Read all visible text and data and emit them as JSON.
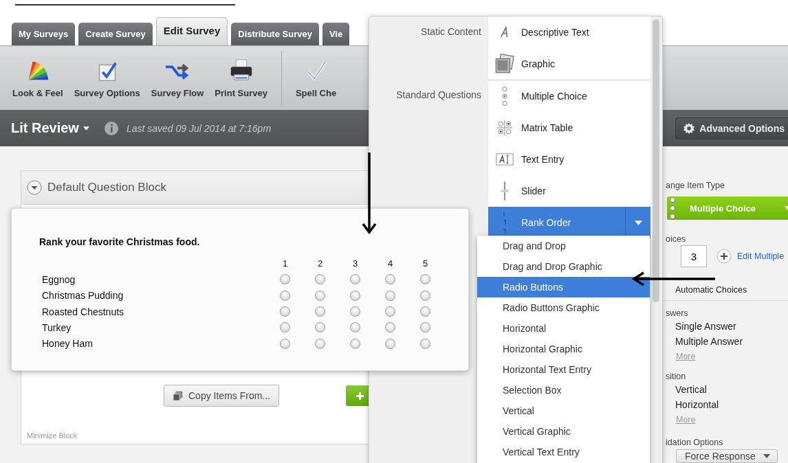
{
  "tabs": [
    {
      "label": "My Surveys",
      "selected": false
    },
    {
      "label": "Create Survey",
      "selected": false
    },
    {
      "label": "Edit Survey",
      "selected": true
    },
    {
      "label": "Distribute Survey",
      "selected": false
    },
    {
      "label": "Vie",
      "selected": false
    }
  ],
  "toolbar": [
    {
      "label": "Look & Feel",
      "kind": "palette"
    },
    {
      "label": "Survey Options",
      "kind": "options"
    },
    {
      "label": "Survey Flow",
      "kind": "flow"
    },
    {
      "label": "Print Survey",
      "kind": "print"
    },
    {
      "label": "Spell Che",
      "kind": "spell"
    }
  ],
  "survey_bar": {
    "title": "Lit Review",
    "last_saved": "Last saved 09 Jul 2014 at 7:16pm",
    "advanced_button": "Advanced Options"
  },
  "block": {
    "title": "Default Question Block",
    "copy_button": "Copy Items From...",
    "minimize_link": "Minimize Block"
  },
  "preview": {
    "question": "Rank your favorite Christmas food.",
    "scale": [
      "1",
      "2",
      "3",
      "4",
      "5"
    ],
    "rows": [
      {
        "label": "Eggnog",
        "checked": [
          false,
          false,
          false,
          false,
          false
        ]
      },
      {
        "label": "Christmas Pudding",
        "checked": [
          false,
          false,
          false,
          false,
          false
        ]
      },
      {
        "label": "Roasted Chestnuts",
        "checked": [
          false,
          false,
          false,
          false,
          false
        ]
      },
      {
        "label": "Turkey",
        "checked": [
          false,
          false,
          false,
          false,
          false
        ]
      },
      {
        "label": "Honey Ham",
        "checked": [
          false,
          false,
          false,
          false,
          false
        ]
      }
    ]
  },
  "question_types": [
    {
      "group": "Static Content",
      "items": [
        {
          "label": "Descriptive Text",
          "kind": "text",
          "selected": false
        },
        {
          "label": "Graphic",
          "kind": "graphic",
          "selected": false
        }
      ]
    },
    {
      "group": "Standard Questions",
      "items": [
        {
          "label": "Multiple Choice",
          "kind": "choice",
          "selected": false
        },
        {
          "label": "Matrix Table",
          "kind": "matrix",
          "selected": false
        },
        {
          "label": "Text Entry",
          "kind": "entry",
          "selected": false
        },
        {
          "label": "Slider",
          "kind": "slider",
          "selected": false
        },
        {
          "label": "Rank Order",
          "kind": "rank",
          "selected": true
        }
      ]
    }
  ],
  "submenu": [
    {
      "label": "Drag and Drop",
      "selected": false
    },
    {
      "label": "Drag and Drop Graphic",
      "selected": false
    },
    {
      "label": "Radio Buttons",
      "selected": true
    },
    {
      "label": "Radio Buttons Graphic",
      "selected": false
    },
    {
      "label": "Horizontal",
      "selected": false
    },
    {
      "label": "Horizontal Graphic",
      "selected": false
    },
    {
      "label": "Horizontal Text Entry",
      "selected": false
    },
    {
      "label": "Selection Box",
      "selected": false
    },
    {
      "label": "Vertical",
      "selected": false
    },
    {
      "label": "Vertical Graphic",
      "selected": false
    },
    {
      "label": "Vertical Text Entry",
      "selected": false
    }
  ],
  "properties": {
    "item_type_label": "ange Item Type",
    "item_type_button": "Multiple Choice",
    "choices_label": "oices",
    "choices_value": "3",
    "edit_multiple_link": "Edit Multiple",
    "automatic_choices": "Automatic Choices",
    "answers_label": "swers",
    "answer_options": [
      "Single Answer",
      "Multiple Answer"
    ],
    "answers_more": "More",
    "position_label": "sition",
    "position_options": [
      "Vertical",
      "Horizontal"
    ],
    "position_more": "More",
    "validation_label": "idation Options",
    "validation_select": "Force Response"
  }
}
